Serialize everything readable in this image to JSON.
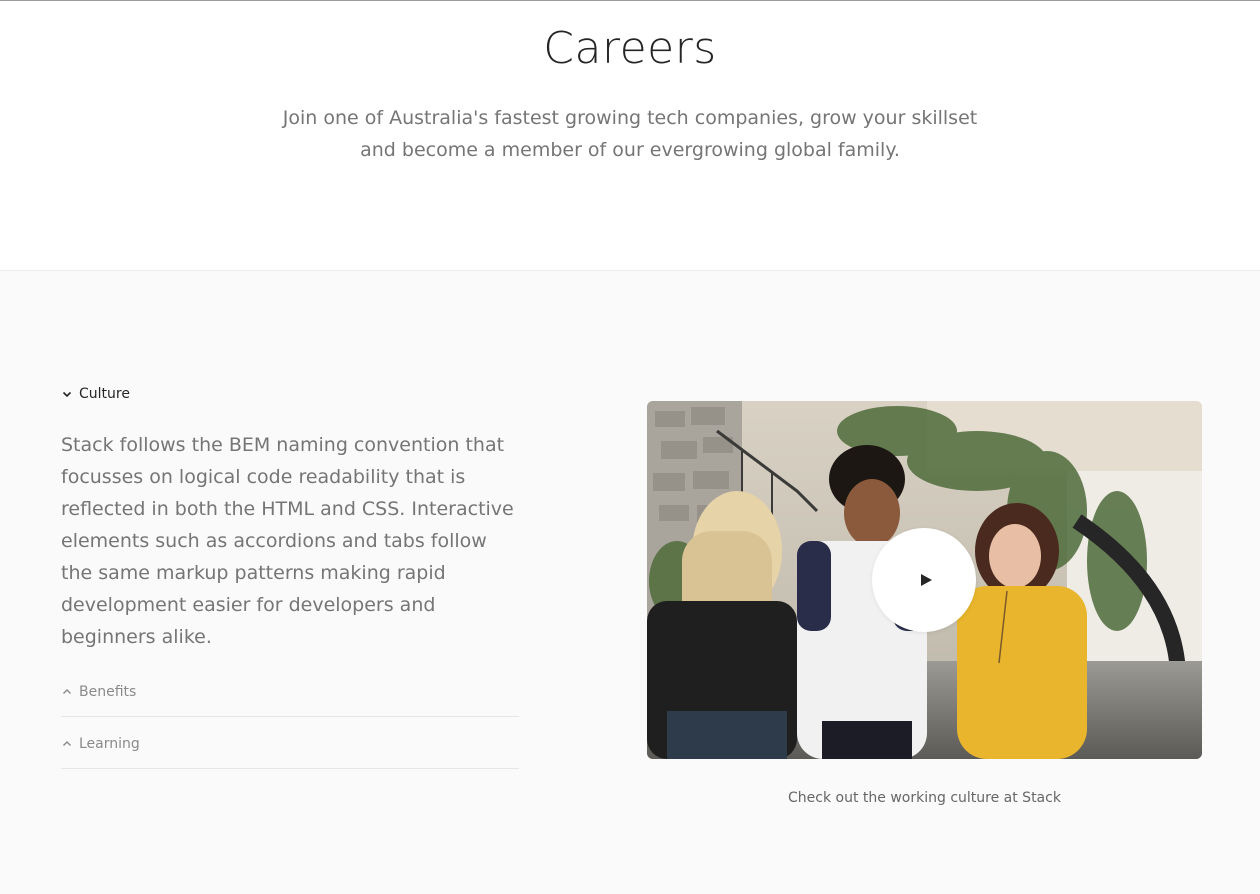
{
  "hero": {
    "title": "Careers",
    "subtitle": "Join one of Australia's fastest growing tech companies, grow your skillset and become a member of our evergrowing global family."
  },
  "accordion": {
    "items": [
      {
        "label": "Culture",
        "expanded": true,
        "body": "Stack follows the BEM naming convention that focusses on logical code readability that is reflected in both the HTML and CSS. Interactive elements such as accordions and tabs follow the same markup patterns making rapid development easier for developers and beginners alike."
      },
      {
        "label": "Benefits",
        "expanded": false
      },
      {
        "label": "Learning",
        "expanded": false
      }
    ]
  },
  "media": {
    "image": "photo of four young people talking outdoors",
    "play_icon": "play-icon",
    "caption": "Check out the working culture at Stack"
  },
  "colors": {
    "heading": "#252525",
    "body_text": "#757575",
    "muted": "#8a8a8a",
    "section_bg": "#fafafa",
    "play_button": "#ffffff"
  }
}
